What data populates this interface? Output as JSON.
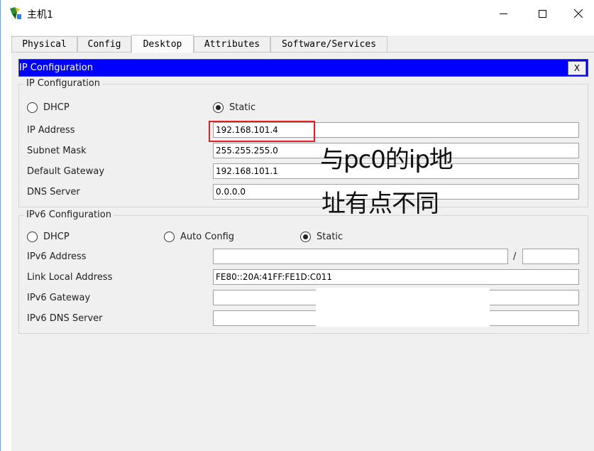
{
  "window": {
    "title": "主机1"
  },
  "tabs": [
    {
      "label": "Physical",
      "active": false
    },
    {
      "label": "Config",
      "active": false
    },
    {
      "label": "Desktop",
      "active": true
    },
    {
      "label": "Attributes",
      "active": false
    },
    {
      "label": "Software/Services",
      "active": false
    }
  ],
  "ip_config_bar": {
    "title": "IP Configuration",
    "close_label": "X"
  },
  "ipv4": {
    "group_title": "IP Configuration",
    "dhcp_label": "DHCP",
    "static_label": "Static",
    "mode": "Static",
    "ip_address_label": "IP Address",
    "ip_address": "192.168.101.4",
    "subnet_mask_label": "Subnet Mask",
    "subnet_mask": "255.255.255.0",
    "gateway_label": "Default Gateway",
    "gateway": "192.168.101.1",
    "dns_label": "DNS Server",
    "dns": "0.0.0.0"
  },
  "ipv6": {
    "group_title": "IPv6 Configuration",
    "dhcp_label": "DHCP",
    "auto_label": "Auto Config",
    "static_label": "Static",
    "mode": "Static",
    "address_label": "IPv6 Address",
    "address": "",
    "slash": "/",
    "prefix": "",
    "link_local_label": "Link Local Address",
    "link_local": "FE80::20A:41FF:FE1D:C011",
    "gateway_label": "IPv6 Gateway",
    "gateway": "",
    "dns_label": "IPv6 DNS Server",
    "dns": ""
  },
  "annotation": {
    "line1": "与pc0的ip地",
    "line2": "址有点不同",
    "highlight_color": "#e02020"
  }
}
